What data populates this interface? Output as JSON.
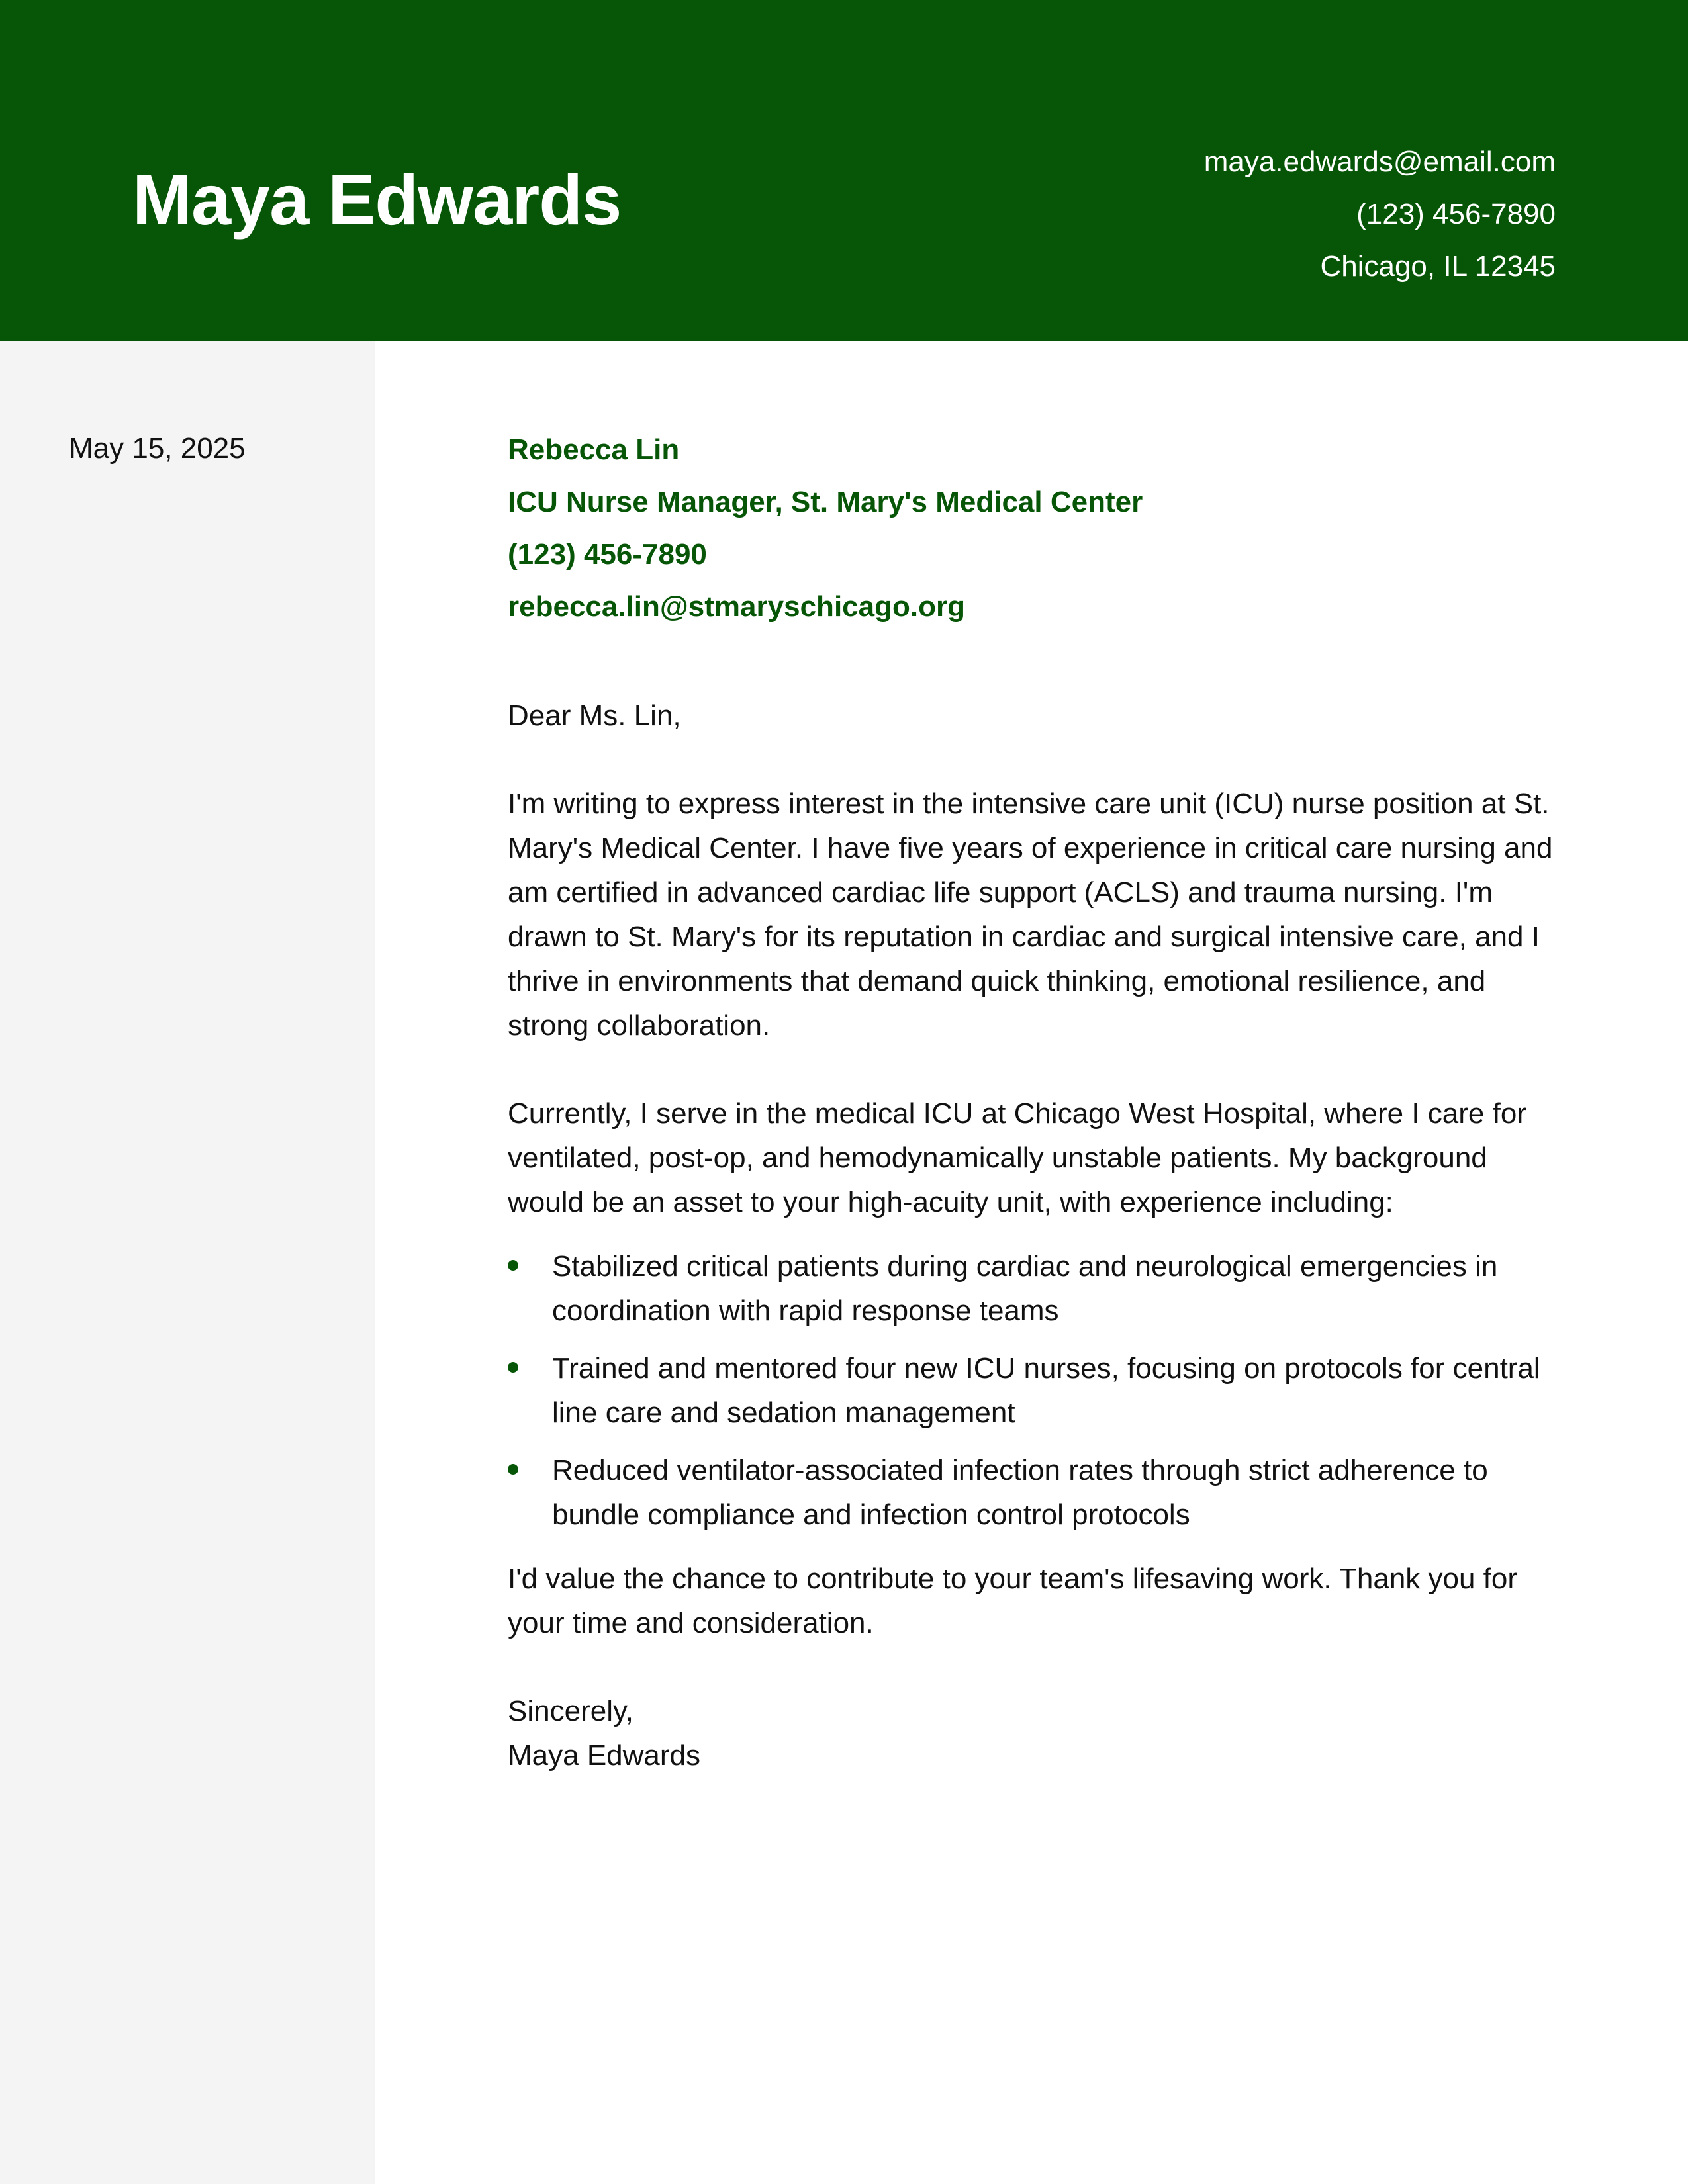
{
  "header": {
    "name": "Maya Edwards",
    "contact": {
      "email": "maya.edwards@email.com",
      "phone": "(123) 456-7890",
      "location": "Chicago, IL 12345"
    },
    "accent_color": "#075607"
  },
  "sidebar": {
    "date": "May 15, 2025"
  },
  "recipient": {
    "name": "Rebecca Lin",
    "title": "ICU Nurse Manager, St. Mary's Medical Center",
    "phone": "(123) 456-7890",
    "email": "rebecca.lin@stmaryschicago.org"
  },
  "letter": {
    "greeting": "Dear Ms. Lin,",
    "paragraph1": "I'm writing to express interest in the intensive care unit (ICU) nurse position at St. Mary's Medical Center. I have five years of experience in critical care nursing and am certified in advanced cardiac life support (ACLS) and trauma nursing. I'm drawn to St. Mary's for its reputation in cardiac and surgical intensive care, and I thrive in environments that demand quick thinking, emotional resilience, and strong collaboration.",
    "paragraph2": "Currently, I serve in the medical ICU at Chicago West Hospital, where I care for ventilated, post-op, and hemodynamically unstable patients. My background would be an asset to your high-acuity unit, with experience including:",
    "bullets": [
      "Stabilized critical patients during cardiac and neurological emergencies in coordination with rapid response teams",
      "Trained and mentored four new ICU nurses, focusing on protocols for central line care and sedation management",
      "Reduced ventilator-associated infection rates through strict adherence to bundle compliance and infection control protocols"
    ],
    "closing": "I'd value the chance to contribute to your team's lifesaving work. Thank you for your time and consideration.",
    "signoff": "Sincerely,",
    "signature": "Maya Edwards"
  }
}
